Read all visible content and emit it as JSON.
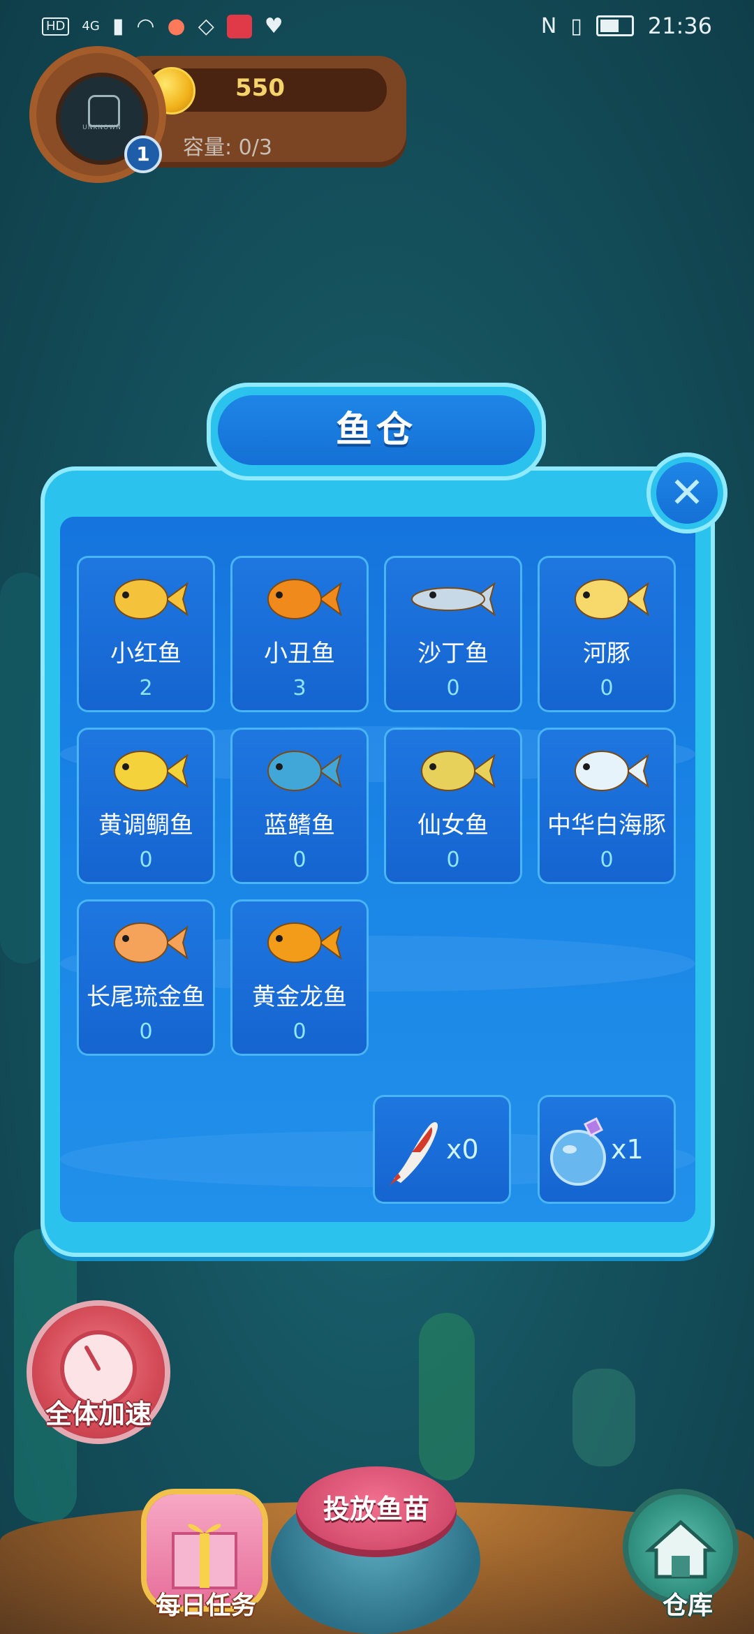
{
  "status_bar": {
    "left_chips": [
      "HD",
      "4G"
    ],
    "time": "21:36"
  },
  "hud": {
    "coins": "550",
    "capacity": "容量: 0/3",
    "level": "1",
    "avatar_caption": "UNKNOWN"
  },
  "dialog": {
    "title": "鱼仓",
    "close_glyph": "✕",
    "fish": [
      {
        "name": "小红鱼",
        "count": "2",
        "icon": "red-fish-icon",
        "color": "#f4c33b"
      },
      {
        "name": "小丑鱼",
        "count": "3",
        "icon": "clownfish-icon",
        "color": "#f08a1c"
      },
      {
        "name": "沙丁鱼",
        "count": "0",
        "icon": "sardine-icon",
        "color": "#c7d9e6"
      },
      {
        "name": "河豚",
        "count": "0",
        "icon": "pufferfish-icon",
        "color": "#f6d86b"
      },
      {
        "name": "黄调鲷鱼",
        "count": "0",
        "icon": "yellow-snapper-icon",
        "color": "#f3d23c"
      },
      {
        "name": "蓝鳍鱼",
        "count": "0",
        "icon": "blue-fin-fish-icon",
        "color": "#41a7d8"
      },
      {
        "name": "仙女鱼",
        "count": "0",
        "icon": "angelfish-icon",
        "color": "#e8d15a"
      },
      {
        "name": "中华白海豚",
        "count": "0",
        "icon": "white-dolphin-icon",
        "color": "#e7f3fa"
      },
      {
        "name": "长尾琉金鱼",
        "count": "0",
        "icon": "fantail-goldfish-icon",
        "color": "#f5a35a"
      },
      {
        "name": "黄金龙鱼",
        "count": "0",
        "icon": "golden-arowana-icon",
        "color": "#f29c1a"
      }
    ],
    "items": [
      {
        "icon": "koi-icon",
        "qty": "x0"
      },
      {
        "icon": "potion-icon",
        "qty": "x1"
      }
    ]
  },
  "bottom": {
    "speed_label": "全体加速",
    "daily_label": "每日任务",
    "release_label": "投放鱼苗",
    "store_label": "仓库"
  }
}
